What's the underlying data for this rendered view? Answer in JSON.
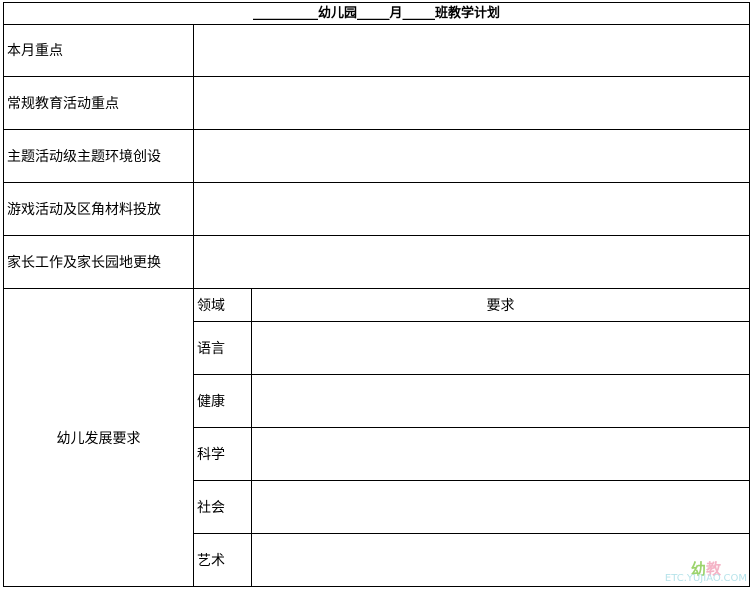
{
  "title": "__________幼儿园_____月_____班教学计划",
  "rows": [
    {
      "label": "本月重点",
      "value": ""
    },
    {
      "label": "常规教育活动重点",
      "value": ""
    },
    {
      "label": "主题活动级主题环境创设",
      "value": ""
    },
    {
      "label": "游戏活动及区角材料投放",
      "value": ""
    },
    {
      "label": "家长工作及家长园地更换",
      "value": ""
    }
  ],
  "development": {
    "label": "幼儿发展要求",
    "header": {
      "domain": "领域",
      "requirement": "要求"
    },
    "domains": [
      {
        "name": "语言",
        "requirement": ""
      },
      {
        "name": "健康",
        "requirement": ""
      },
      {
        "name": "科学",
        "requirement": ""
      },
      {
        "name": "社会",
        "requirement": ""
      },
      {
        "name": "艺术",
        "requirement": ""
      }
    ]
  },
  "watermark": {
    "line1a": "幼",
    "line1b": "教",
    "line2": "ETC.YUJIAO.COM"
  }
}
